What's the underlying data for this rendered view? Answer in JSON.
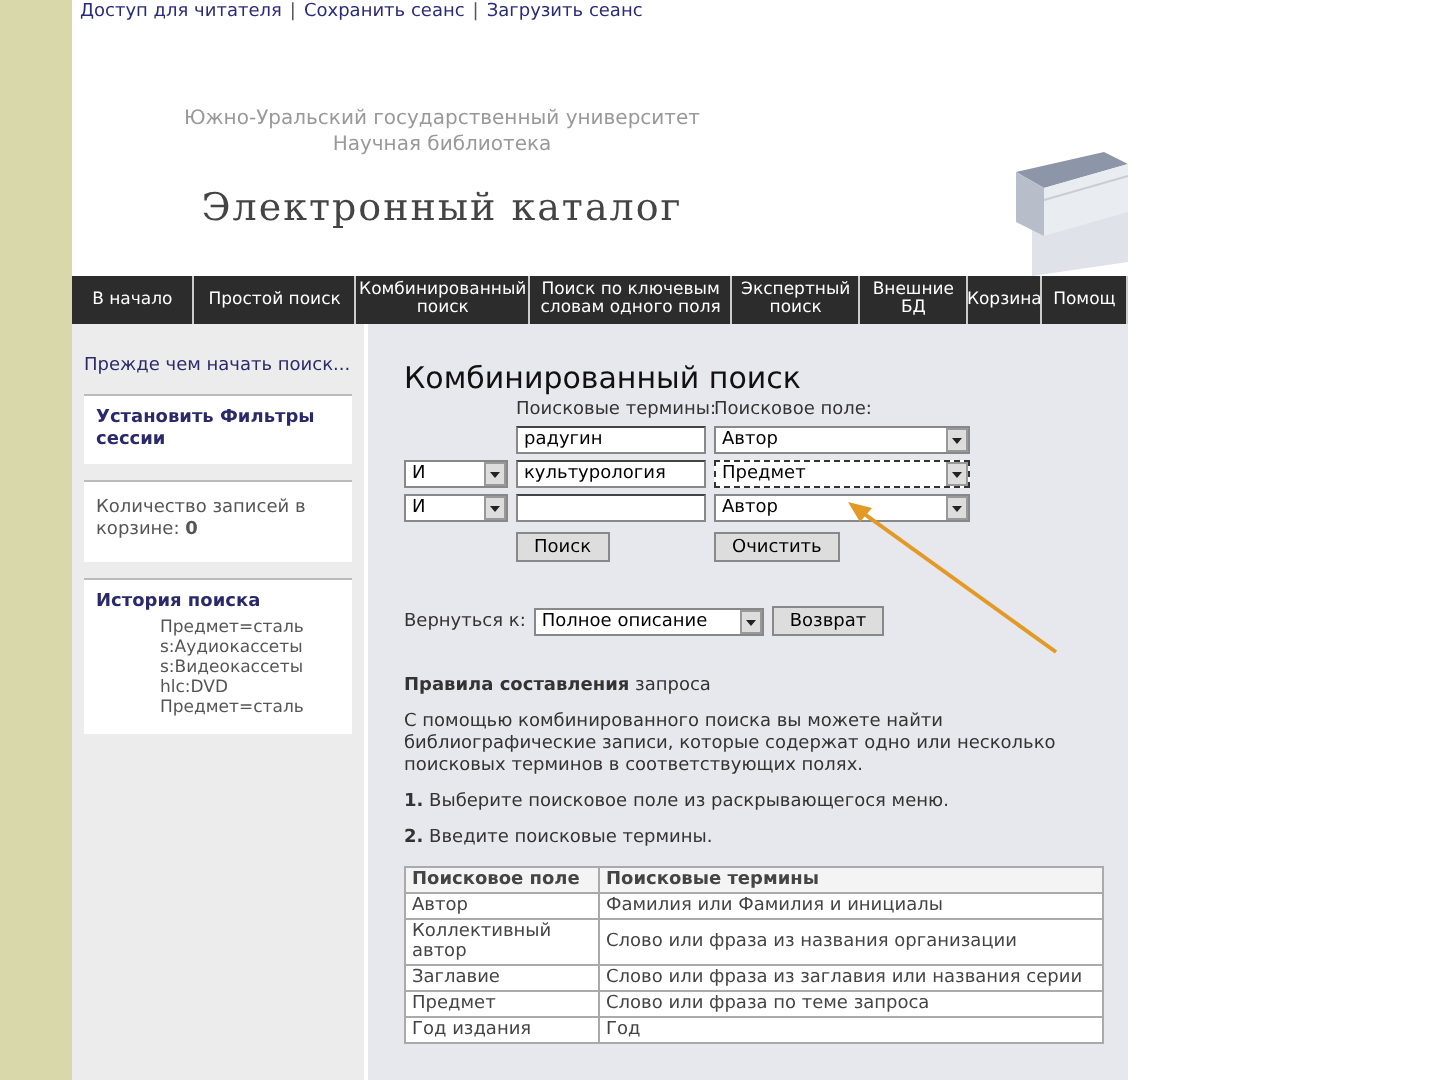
{
  "top_links": {
    "items": [
      "Доступ для читателя",
      "Сохранить сеанс",
      "Загрузить сеанс"
    ],
    "separator": "|"
  },
  "header": {
    "university": "Южно-Уральский государственный университет",
    "library": "Научная библиотека",
    "title": "Электронный каталог"
  },
  "nav": [
    "В начало",
    "Простой поиск",
    "Комбинированный поиск",
    "Поиск по ключевым словам одного поля",
    "Экспертный поиск",
    "Внешние БД",
    "Корзина",
    "Помощ"
  ],
  "sidebar": {
    "intro_link": "Прежде чем начать поиск...",
    "filters_link": "Установить Фильтры сессии",
    "basket": "Количество записей в корзине: **0**",
    "history": {
      "title": "История поиска",
      "items": [
        "Предмет=сталь",
        "s:Аудиокассеты",
        "s:Видеокассеты",
        "hlc:DVD",
        "Предмет=сталь"
      ]
    }
  },
  "search": {
    "title": "Комбинированный поиск",
    "terms_label": "Поисковые термины:",
    "field_label": "Поисковое поле:",
    "rows": [
      {
        "term": "радугин",
        "field": "Автор",
        "focused": false
      },
      {
        "operator": "И",
        "term": "культурология",
        "field": "Предмет",
        "focused": true
      },
      {
        "operator": "И",
        "field": "Автор",
        "focused": false
      }
    ],
    "buttons": [
      "Поиск",
      "Очистить"
    ],
    "return": {
      "label": "Вернуться к:",
      "value": "Полное описание",
      "button": "Возврат"
    }
  },
  "rules": {
    "heading": "**Правила составления** запроса",
    "intro": "С помощью комбинированного поиска вы можете найти библиографические записи, которые содержат одно или несколько поисковых терминов в соответствующих полях.",
    "steps": [
      "**1.** Выберите поисковое поле из раскрывающегося меню.",
      "**2.** Введите поисковые термины."
    ],
    "table": {
      "columns": [
        "Поисковое поле",
        "Поисковые термины"
      ],
      "rows": [
        [
          "Автор",
          "Фамилия или Фамилия и инициалы"
        ],
        [
          "Коллективный автор",
          "Слово или фраза из названия организации"
        ],
        [
          "Заглавие",
          "Слово или фраза из заглавия или названия серии"
        ],
        [
          "Предмет",
          "Слово или фраза по теме запроса"
        ],
        [
          "Год издания",
          "Год"
        ]
      ]
    }
  }
}
